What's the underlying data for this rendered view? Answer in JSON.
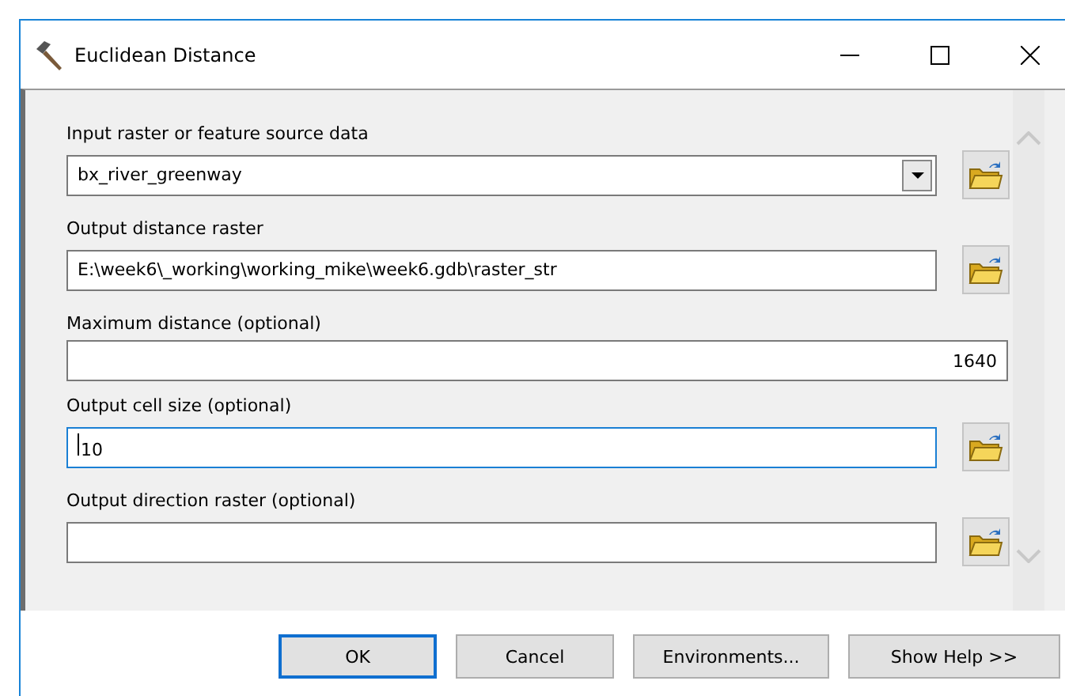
{
  "window": {
    "title": "Euclidean Distance",
    "controls": [
      {
        "kind": "minimize"
      },
      {
        "kind": "maximize"
      },
      {
        "kind": "close"
      }
    ]
  },
  "parameters": [
    {
      "label": "Input raster or feature source data",
      "kind": "dropdown",
      "value": "bx_river_greenway",
      "focused": false,
      "browse": true
    },
    {
      "label": "Output distance raster",
      "kind": "path",
      "value": "E:\\week6\\_working\\working_mike\\week6.gdb\\raster_str",
      "focused": false,
      "browse": true
    },
    {
      "label": "Maximum distance (optional)",
      "kind": "number",
      "value": "1640",
      "focused": false,
      "browse": false
    },
    {
      "label": "Output cell size (optional)",
      "kind": "path",
      "value": "10",
      "focused": true,
      "browse": true
    },
    {
      "label": "Output direction raster (optional)",
      "kind": "path",
      "focused": false,
      "browse": true
    }
  ],
  "buttons": [
    {
      "label": "OK",
      "default": true
    },
    {
      "label": "Cancel",
      "default": false
    },
    {
      "label": "Environments...",
      "default": false
    },
    {
      "label": "Show Help >>",
      "default": false
    }
  ]
}
